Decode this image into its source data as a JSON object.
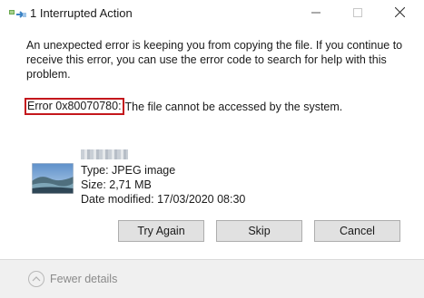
{
  "window": {
    "title": "1 Interrupted Action",
    "icon": "copy-arrow-icon",
    "controls": [
      "minimize-icon",
      "maximize-icon",
      "close-icon"
    ]
  },
  "message": {
    "text": "An unexpected error is keeping you from copying the file. If you continue to receive this error, you can use the error code to search for help with this problem."
  },
  "error": {
    "code": "Error 0x80070780:",
    "description": "The file cannot be accessed by the system.",
    "highlight_color": "#c4171c"
  },
  "file": {
    "thumbnail": "landscape-image-thumbnail",
    "type": "Type: JPEG image",
    "size": "Size: 2,71 MB",
    "modified": "Date modified: 17/03/2020 08:30"
  },
  "buttons": {
    "try_again": "Try Again",
    "skip": "Skip",
    "cancel": "Cancel"
  },
  "footer": {
    "toggle_label": "Fewer details",
    "toggle_icon": "chevron-up-icon"
  }
}
